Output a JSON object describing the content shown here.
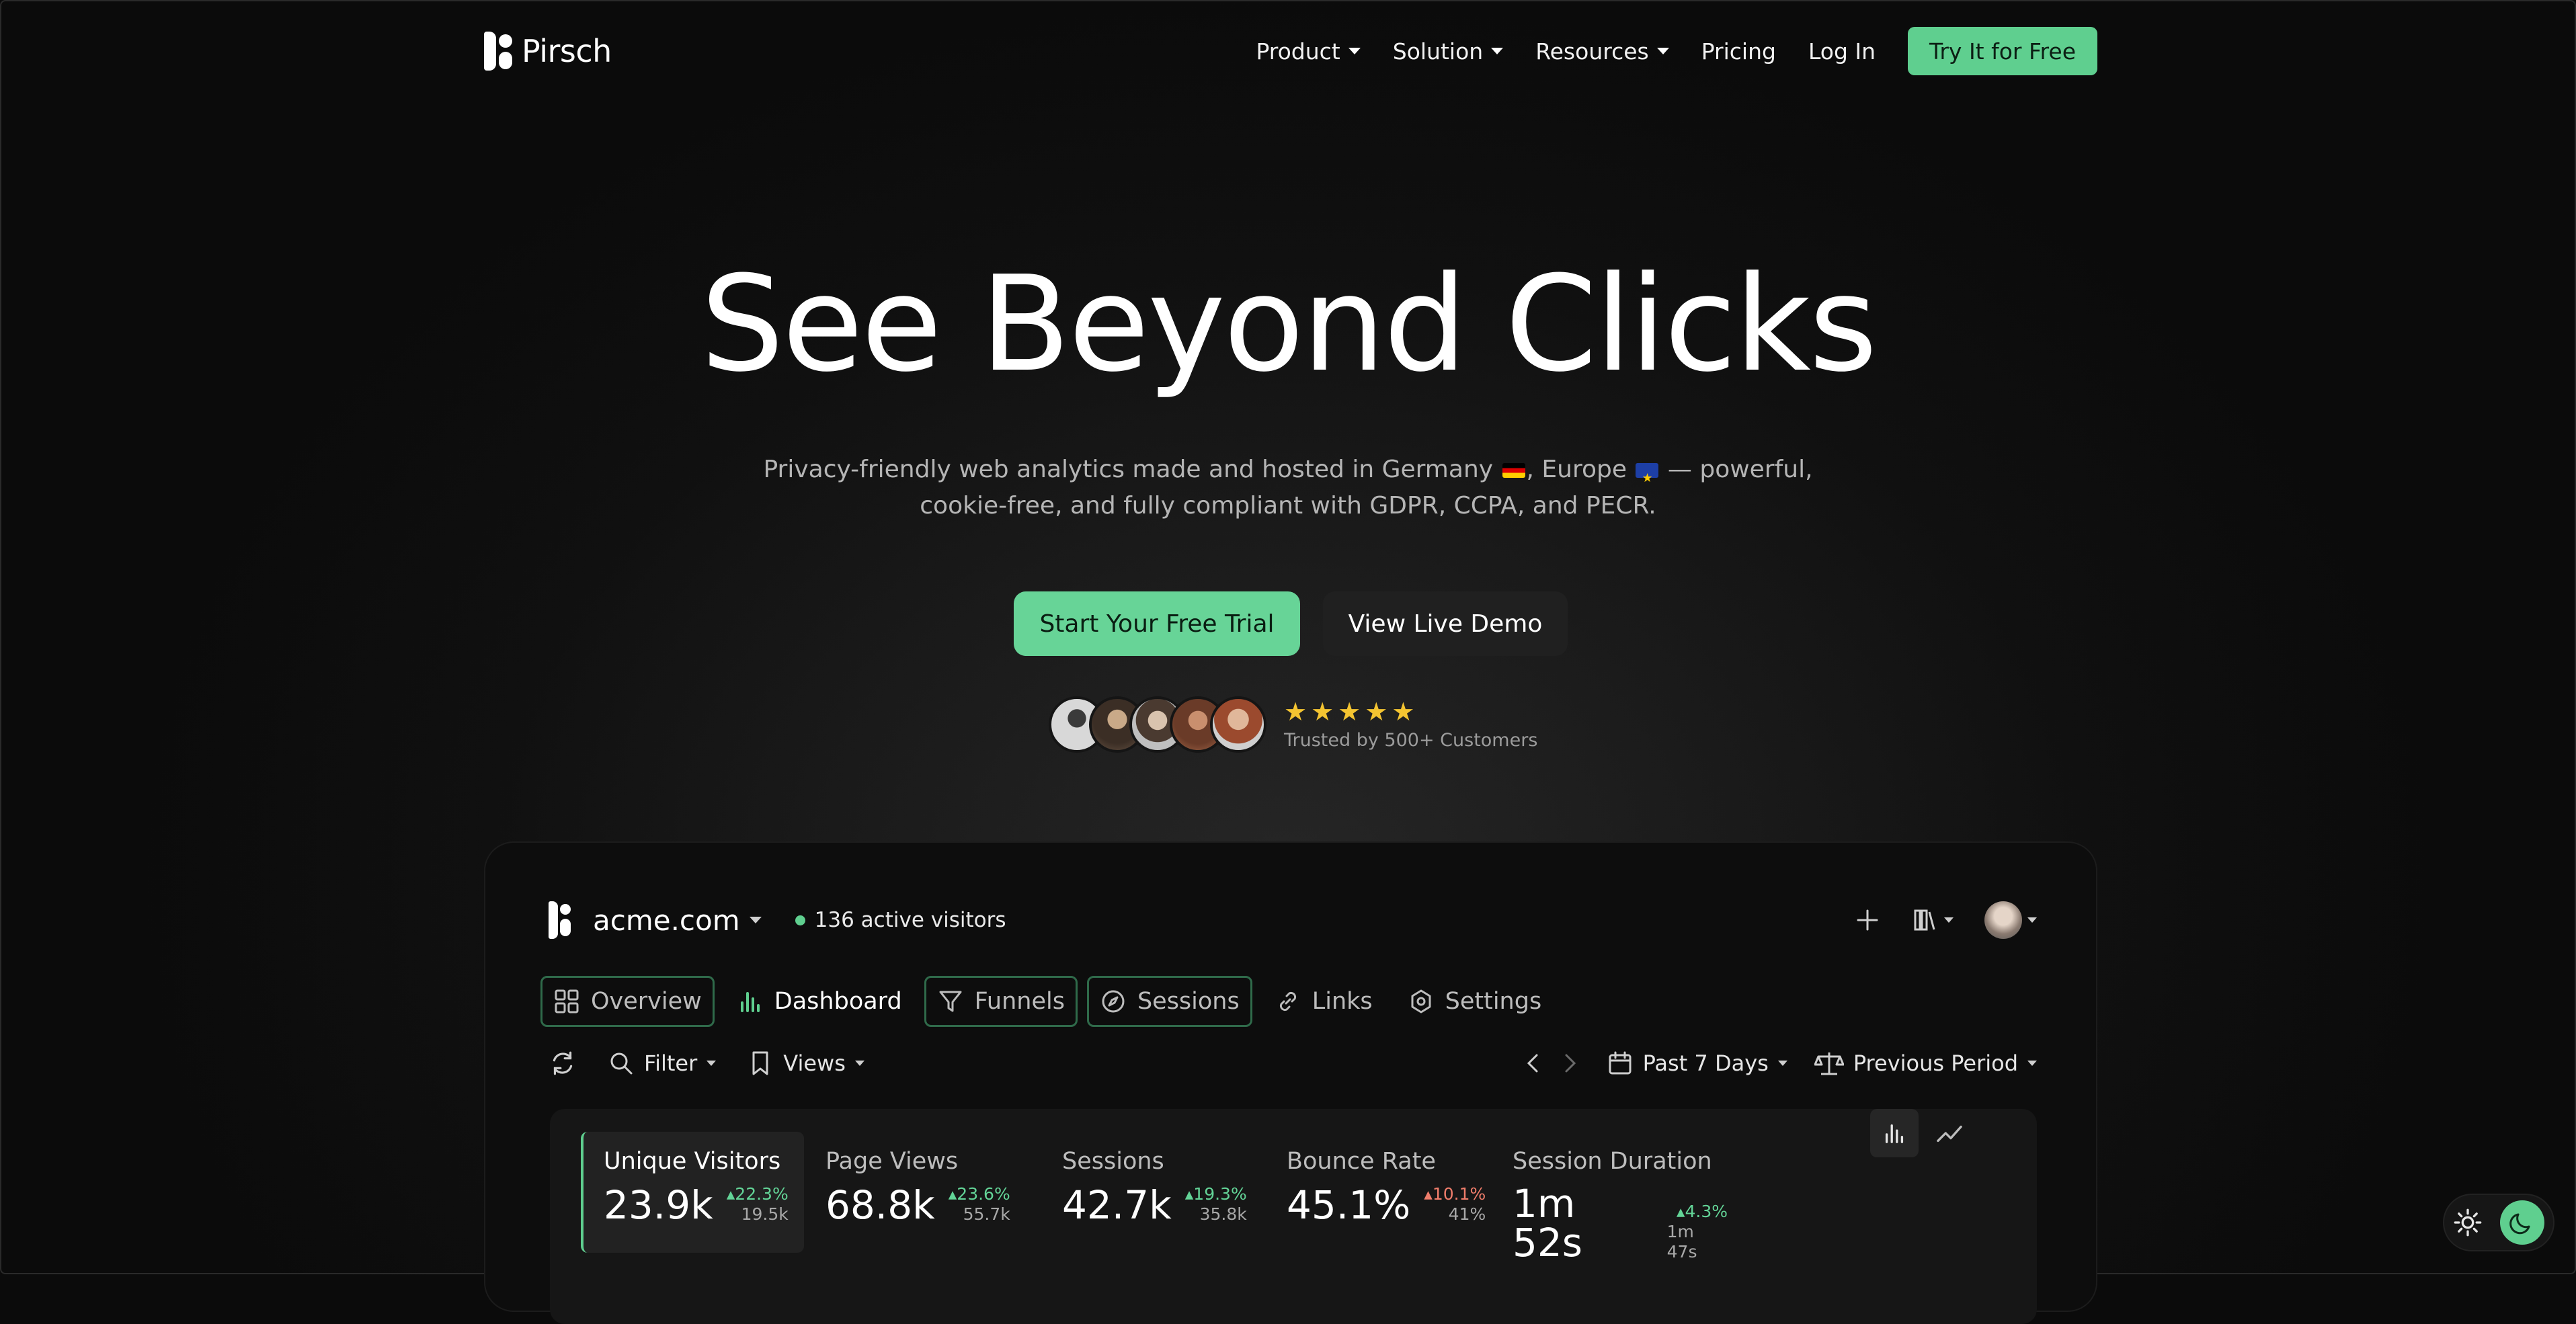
{
  "nav": {
    "brand": "Pirsch",
    "items": [
      {
        "label": "Product",
        "has_menu": true
      },
      {
        "label": "Solution",
        "has_menu": true
      },
      {
        "label": "Resources",
        "has_menu": true
      },
      {
        "label": "Pricing",
        "has_menu": false
      },
      {
        "label": "Log In",
        "has_menu": false
      }
    ],
    "cta": "Try It for Free"
  },
  "hero": {
    "title": "See Beyond Clicks",
    "subtitle_part1": "Privacy-friendly web analytics made and hosted in Germany",
    "subtitle_part2": ", Europe",
    "subtitle_part3": " — powerful,",
    "subtitle_line2": "cookie-free, and fully compliant with GDPR, CCPA, and PECR.",
    "primary_cta": "Start Your Free Trial",
    "secondary_cta": "View Live Demo",
    "rating_stars": 5,
    "trust_label": "Trusted by 500+ Customers"
  },
  "dashboard": {
    "site": "acme.com",
    "active_visitors": "136 active visitors",
    "tabs": [
      {
        "label": "Overview",
        "icon": "grid-icon",
        "outlined": true,
        "active": false
      },
      {
        "label": "Dashboard",
        "icon": "bar-chart-icon",
        "outlined": false,
        "active": true
      },
      {
        "label": "Funnels",
        "icon": "funnel-icon",
        "outlined": true,
        "active": false
      },
      {
        "label": "Sessions",
        "icon": "compass-icon",
        "outlined": true,
        "active": false
      },
      {
        "label": "Links",
        "icon": "link-icon",
        "outlined": false,
        "active": false
      },
      {
        "label": "Settings",
        "icon": "gear-icon",
        "outlined": false,
        "active": false
      }
    ],
    "toolbar": {
      "filter": "Filter",
      "views": "Views",
      "period": "Past 7 Days",
      "compare": "Previous Period"
    },
    "stats": [
      {
        "label": "Unique Visitors",
        "value": "23.9k",
        "delta": "22.3%",
        "direction": "up",
        "previous": "19.5k",
        "active": true
      },
      {
        "label": "Page Views",
        "value": "68.8k",
        "delta": "23.6%",
        "direction": "up",
        "previous": "55.7k",
        "active": false
      },
      {
        "label": "Sessions",
        "value": "42.7k",
        "delta": "19.3%",
        "direction": "up",
        "previous": "35.8k",
        "active": false
      },
      {
        "label": "Bounce Rate",
        "value": "45.1%",
        "delta": "10.1%",
        "direction": "down",
        "previous": "41%",
        "active": false
      },
      {
        "label": "Session Duration",
        "value": "1m 52s",
        "delta": "4.3%",
        "direction": "up",
        "previous": "1m 47s",
        "active": false
      }
    ]
  },
  "colors": {
    "accent": "#5fcf8f",
    "background": "#0b0b0b",
    "negative": "#ef7d6b",
    "star": "#f4c431"
  }
}
